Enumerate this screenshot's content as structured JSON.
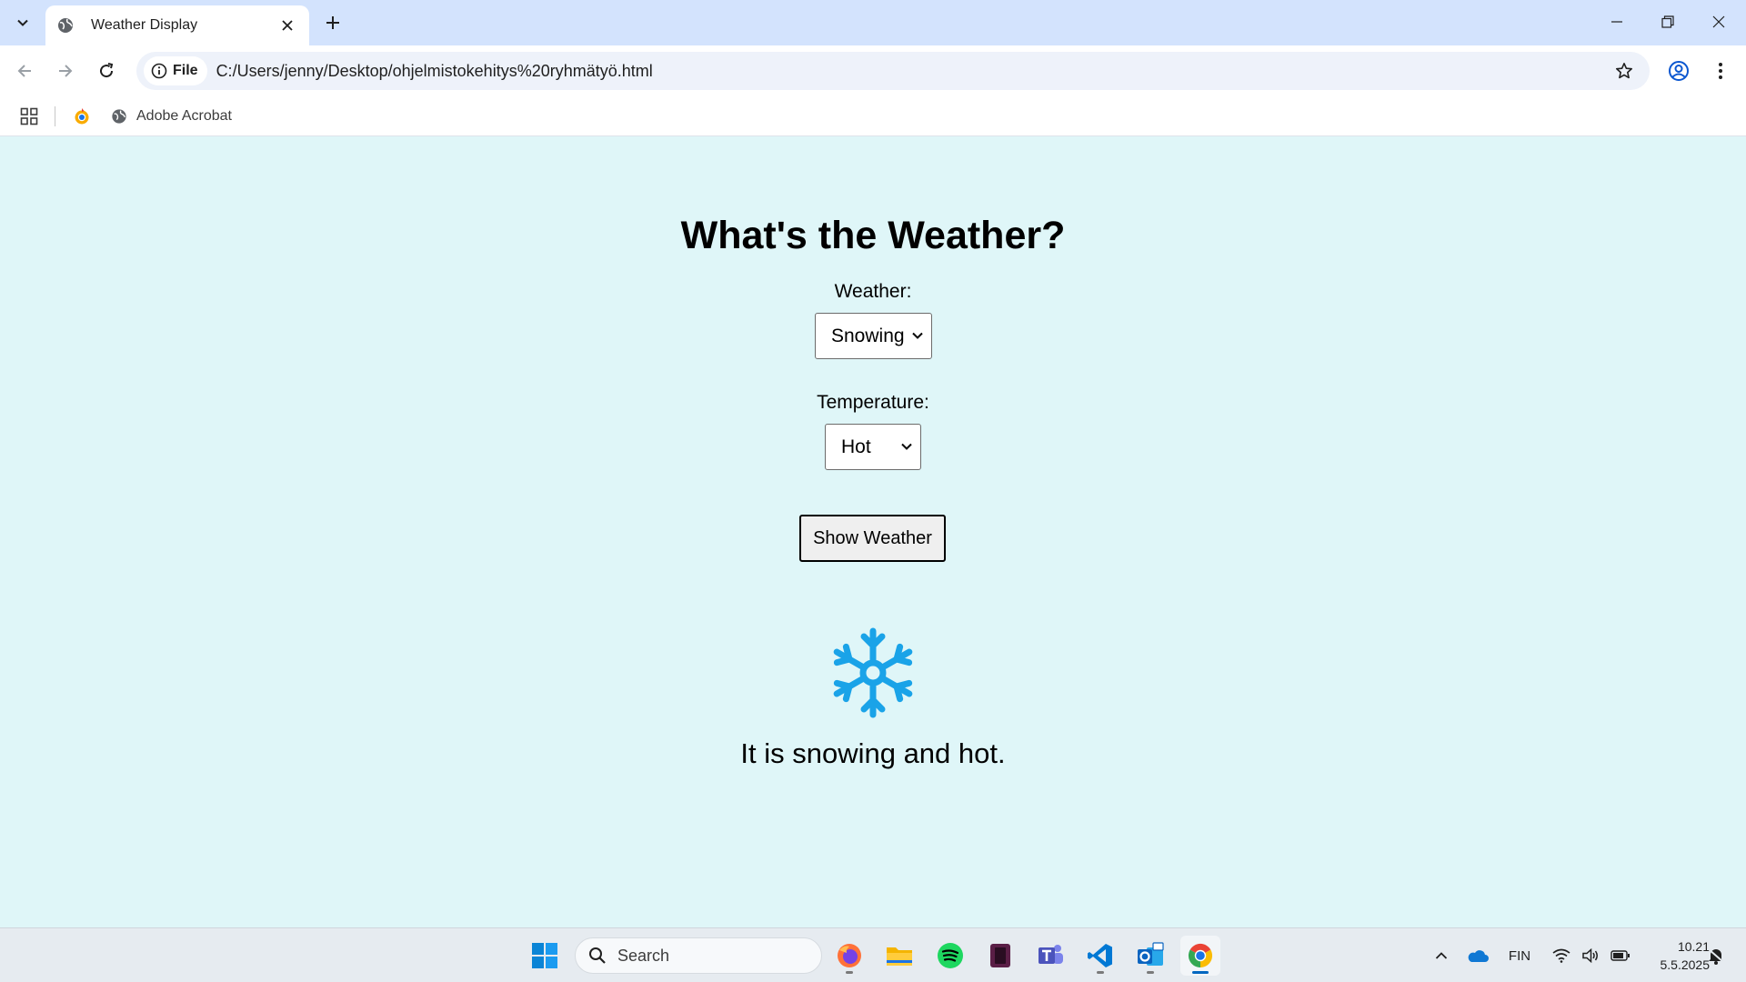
{
  "browser": {
    "tab_title": "Weather Display",
    "url_chip_label": "File",
    "url": "C:/Users/jenny/Desktop/ohjelmistokehitys%20ryhmätyö.html",
    "bookmarks": [
      {
        "label": "",
        "icon": "chrome-app-icon"
      },
      {
        "label": "Adobe Acrobat",
        "icon": "globe-icon"
      }
    ]
  },
  "page": {
    "heading": "What's the Weather?",
    "weather_label": "Weather:",
    "weather_selected": "Snowing",
    "temperature_label": "Temperature:",
    "temperature_selected": "Hot",
    "button_label": "Show Weather",
    "weather_icon": "snowflake-icon",
    "result_text": "It is snowing and hot.",
    "accent_color": "#1aa3e8"
  },
  "taskbar": {
    "search_placeholder": "Search",
    "apps": [
      "start-icon",
      "firefox-icon",
      "file-explorer-icon",
      "spotify-icon",
      "app-icon",
      "teams-icon",
      "vscode-icon",
      "outlook-icon",
      "chrome-icon"
    ],
    "language": "FIN",
    "time": "10.21",
    "date": "5.5.2025"
  }
}
